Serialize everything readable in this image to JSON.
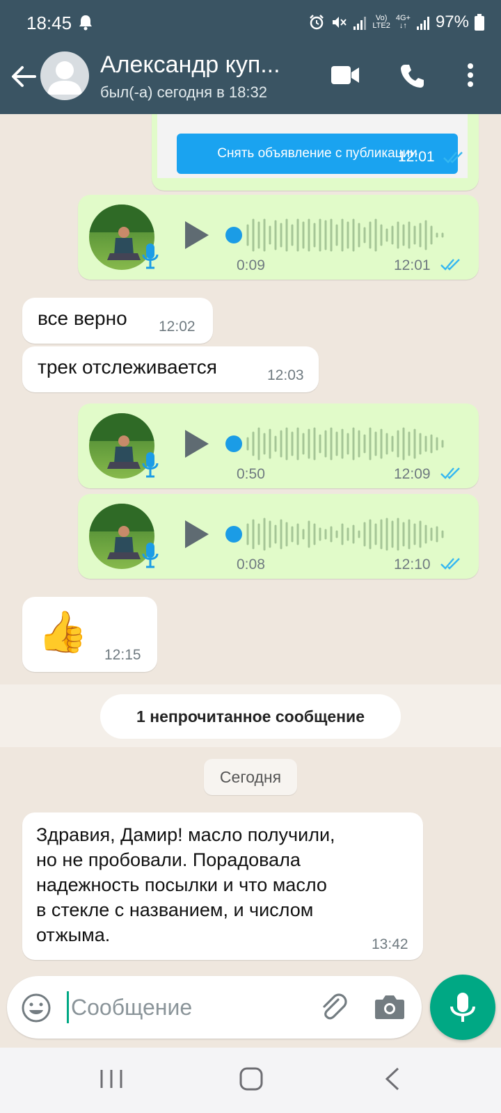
{
  "status_bar": {
    "time": "18:45",
    "network_top": "Vo)",
    "network_bottom": "LTE2",
    "data_top": "4G+",
    "battery": "97%"
  },
  "header": {
    "contact_name": "Александр куп...",
    "contact_status": "был(-а) сегодня в 18:32"
  },
  "messages": {
    "card": {
      "button_label": "Снять объявление с публикации",
      "time": "12:01"
    },
    "voice1": {
      "duration": "0:09",
      "time": "12:01"
    },
    "text1": {
      "text": "все верно",
      "time": "12:02"
    },
    "text2": {
      "text": "трек отслеживается",
      "time": "12:03"
    },
    "voice2": {
      "duration": "0:50",
      "time": "12:09"
    },
    "voice3": {
      "duration": "0:08",
      "time": "12:10"
    },
    "emoji_msg": {
      "emoji": "👍",
      "time": "12:15"
    },
    "unread_banner": "1 непрочитанное сообщение",
    "date_divider": "Сегодня",
    "last": {
      "lines": [
        "Здравия, Дамир! масло получили,",
        "но не пробовали. Порадовала",
        "надежность посылки и что масло",
        "в стекле с названием, и числом",
        "отжыма."
      ],
      "time": "13:42"
    }
  },
  "input": {
    "placeholder": "Сообщение"
  },
  "colors": {
    "header": "#3a5463",
    "outgoing_bubble": "#e1fbc9",
    "incoming_bubble": "#ffffff",
    "accent": "#00a884",
    "read_ticks": "#34b7f1",
    "chat_background": "#efe7de"
  }
}
